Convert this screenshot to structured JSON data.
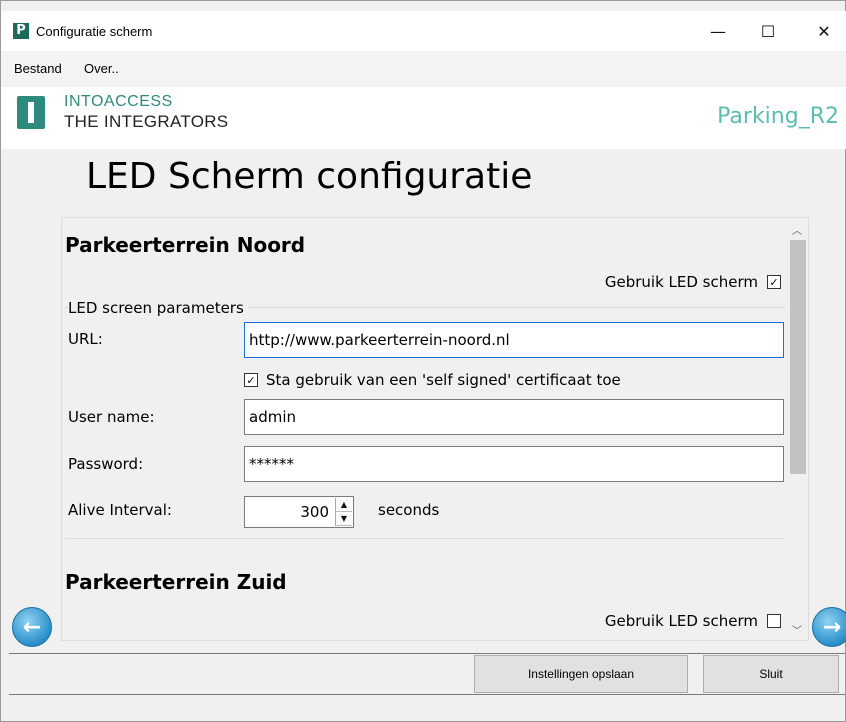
{
  "window": {
    "title": "Configuratie scherm",
    "app_icon_letter": "P",
    "minimize_glyph": "—",
    "maximize_glyph": "☐",
    "close_glyph": "✕"
  },
  "menu": {
    "items": [
      "Bestand",
      "Over.."
    ]
  },
  "header": {
    "logo_line1": "INTOACCESS",
    "logo_line2": "THE INTEGRATORS",
    "profile_name": "Parking_R2",
    "brand_color": "#2e8a7d",
    "accent_color": "#5cbcb0"
  },
  "page": {
    "title": "LED Scherm configuratie"
  },
  "sections": [
    {
      "title": "Parkeerterrein Noord",
      "use_led_label": "Gebruik LED scherm",
      "use_led_checked": true,
      "checked_glyph": "✓",
      "params_legend": "LED screen parameters",
      "url_label": "URL:",
      "url_value": "http://www.parkeerterrein-noord.nl",
      "self_signed_label": "Sta gebruik van een 'self signed' certificaat toe",
      "self_signed_checked": true,
      "username_label": "User name:",
      "username_value": "admin",
      "password_label": "Password:",
      "password_value": "******",
      "alive_label": "Alive Interval:",
      "alive_value": "300",
      "alive_unit": "seconds"
    },
    {
      "title": "Parkeerterrein Zuid",
      "use_led_label": "Gebruik LED scherm",
      "use_led_checked": false
    }
  ],
  "footer": {
    "save_label": "Instellingen opslaan",
    "close_label": "Sluit"
  }
}
